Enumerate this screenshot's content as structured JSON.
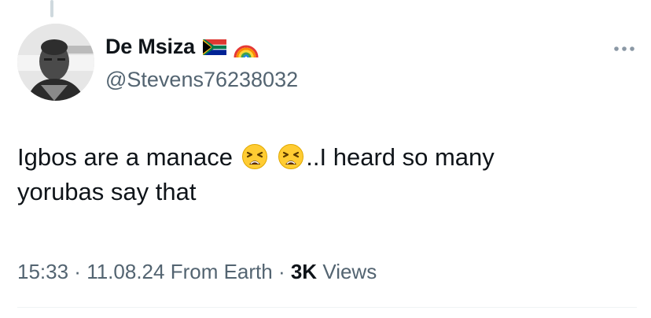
{
  "author": {
    "display_name": "De Msiza",
    "handle": "@Stevens76238032"
  },
  "icons": {
    "avatar": "avatar-photo",
    "flag": "south-africa-flag-icon",
    "rainbow": "rainbow-icon",
    "more": "more-options-icon",
    "emoji": "tired-face-emoji"
  },
  "tweet": {
    "text_line1_a": "Igbos are a manace",
    "text_line1_b": "..I heard so many",
    "text_line2": "yorubas say that"
  },
  "meta": {
    "time": "15:33",
    "sep1": " · ",
    "date": "11.08.24",
    "source": "From Earth",
    "sep2": " · ",
    "views_count": "3K",
    "views_label": "Views"
  },
  "colors": {
    "text": "#0f1419",
    "secondary": "#536471",
    "divider": "#eff3f4"
  }
}
